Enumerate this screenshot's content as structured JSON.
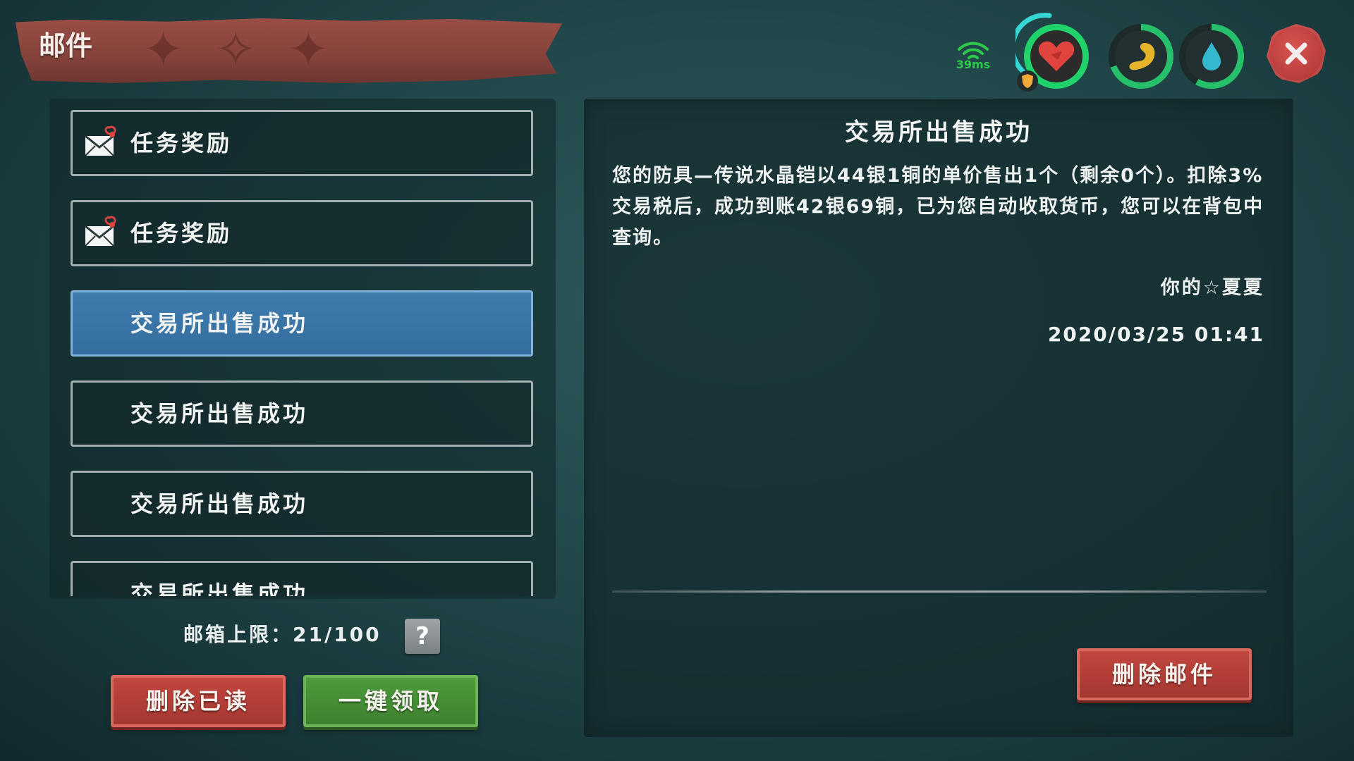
{
  "header": {
    "title": "邮件",
    "ping": "39ms"
  },
  "status_icons": {
    "health": "heart-icon",
    "stamina": "stomach-icon",
    "water": "water-drop-icon",
    "close": "close-icon"
  },
  "mail_list": {
    "items": [
      {
        "label": "任务奖励",
        "icon": "envelope-icon",
        "selected": false
      },
      {
        "label": "任务奖励",
        "icon": "envelope-icon",
        "selected": false
      },
      {
        "label": "交易所出售成功",
        "selected": true
      },
      {
        "label": "交易所出售成功",
        "selected": false
      },
      {
        "label": "交易所出售成功",
        "selected": false
      },
      {
        "label": "交易所出售成功",
        "selected": false
      }
    ]
  },
  "footer": {
    "quota_label": "邮箱上限：21/100",
    "help_label": "?",
    "delete_read_label": "删除已读",
    "claim_all_label": "一键领取"
  },
  "detail": {
    "title": "交易所出售成功",
    "body": "您的防具—传说水晶铠以44银1铜的单价售出1个（剩余0个）。扣除3%交易税后，成功到账42银69铜，已为您自动收取货币，您可以在背包中查询。",
    "sender": "你的☆夏夏",
    "date": "2020/03/25 01:41",
    "delete_label": "删除邮件"
  },
  "colors": {
    "background": "#21474a",
    "banner": "#85433c",
    "selected_item": "#3f7cad",
    "red_button": "#b03e37",
    "green_button": "#468d36",
    "ping_green": "#2ec84a"
  }
}
